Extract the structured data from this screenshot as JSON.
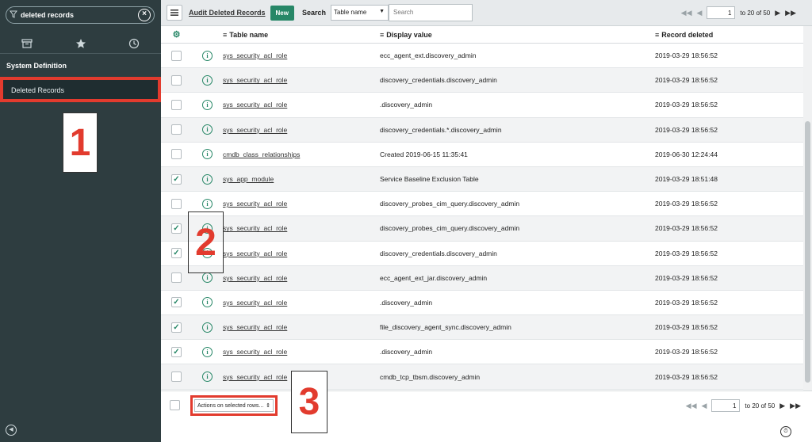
{
  "sidebar": {
    "filter_value": "deleted records",
    "section": "System Definition",
    "module": "Deleted Records"
  },
  "header": {
    "title": "Audit Deleted Records",
    "new_label": "New",
    "search_label": "Search",
    "search_field": "Table name",
    "search_placeholder": "Search",
    "page_value": "1",
    "range_text": "to 20 of 50"
  },
  "table": {
    "columns": [
      "Table name",
      "Display value",
      "Record deleted"
    ],
    "rows": [
      {
        "checked": false,
        "table": "sys_security_acl_role",
        "display": "ecc_agent_ext.discovery_admin",
        "deleted": "2019-03-29 18:56:52"
      },
      {
        "checked": false,
        "table": "sys_security_acl_role",
        "display": "discovery_credentials.discovery_admin",
        "deleted": "2019-03-29 18:56:52"
      },
      {
        "checked": false,
        "table": "sys_security_acl_role",
        "display": ".discovery_admin",
        "deleted": "2019-03-29 18:56:52"
      },
      {
        "checked": false,
        "table": "sys_security_acl_role",
        "display": "discovery_credentials.*.discovery_admin",
        "deleted": "2019-03-29 18:56:52"
      },
      {
        "checked": false,
        "table": "cmdb_class_relationships",
        "display": "Created 2019-06-15 11:35:41",
        "deleted": "2019-06-30 12:24:44"
      },
      {
        "checked": true,
        "table": "sys_app_module",
        "display": "Service Baseline Exclusion Table",
        "deleted": "2019-03-29 18:51:48"
      },
      {
        "checked": false,
        "table": "sys_security_acl_role",
        "display": "discovery_probes_cim_query.discovery_admin",
        "deleted": "2019-03-29 18:56:52"
      },
      {
        "checked": true,
        "table": "sys_security_acl_role",
        "display": "discovery_probes_cim_query.discovery_admin",
        "deleted": "2019-03-29 18:56:52"
      },
      {
        "checked": true,
        "table": "sys_security_acl_role",
        "display": "discovery_credentials.discovery_admin",
        "deleted": "2019-03-29 18:56:52"
      },
      {
        "checked": false,
        "table": "sys_security_acl_role",
        "display": "ecc_agent_ext_jar.discovery_admin",
        "deleted": "2019-03-29 18:56:52"
      },
      {
        "checked": true,
        "table": "sys_security_acl_role",
        "display": ".discovery_admin",
        "deleted": "2019-03-29 18:56:52"
      },
      {
        "checked": true,
        "table": "sys_security_acl_role",
        "display": "file_discovery_agent_sync.discovery_admin",
        "deleted": "2019-03-29 18:56:52"
      },
      {
        "checked": true,
        "table": "sys_security_acl_role",
        "display": ".discovery_admin",
        "deleted": "2019-03-29 18:56:52"
      },
      {
        "checked": false,
        "table": "sys_security_acl_role",
        "display": "cmdb_tcp_tbsm.discovery_admin",
        "deleted": "2019-03-29 18:56:52"
      }
    ]
  },
  "footer": {
    "actions_label": "Actions on selected rows...",
    "page_value": "1",
    "range_text": "to 20 of 50"
  },
  "callouts": [
    "1",
    "2",
    "3"
  ],
  "icons": {
    "filter": "funnel-icon",
    "clear": "clear-circle-icon",
    "archive": "archive-icon",
    "favorites": "star-icon",
    "history": "clock-icon",
    "settings": "gear-icon",
    "info": "info-icon",
    "menu": "hamburger-icon",
    "collapse": "collapse-arrow-icon",
    "timer": "stopwatch-icon"
  },
  "colors": {
    "sidebar_bg": "#2e3d40",
    "accent_green": "#278767",
    "highlight_red": "#e23b2e"
  }
}
